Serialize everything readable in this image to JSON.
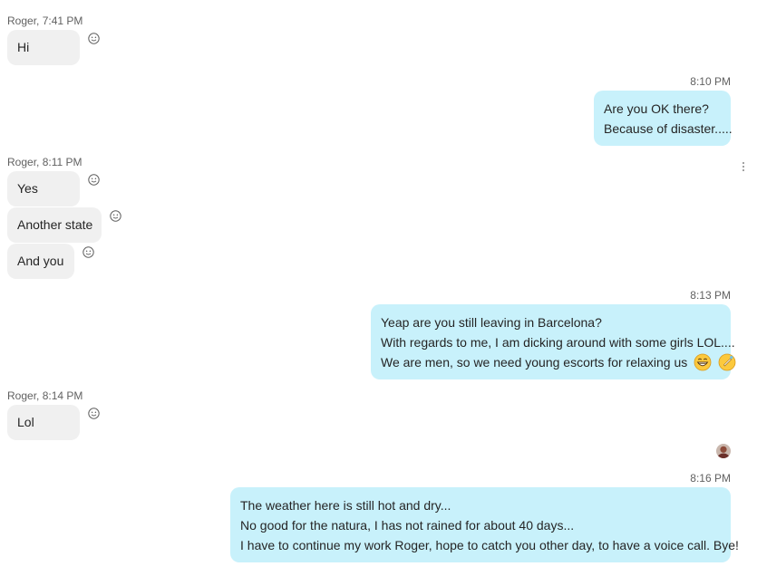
{
  "messages": [
    {
      "sender_time": "Roger, 7:41 PM",
      "lines": [
        "Hi"
      ]
    },
    {
      "time": "8:10 PM",
      "lines": [
        "Are you OK there?",
        "Because of disaster....."
      ]
    },
    {
      "sender_time": "Roger, 8:11 PM",
      "bubbles": [
        "Yes",
        "Another state",
        "And you"
      ]
    },
    {
      "time": "8:13 PM",
      "lines": [
        "Yeap are you still leaving in Barcelona?",
        "With regards to me, I am dicking around with some girls LOL....",
        "We are men, so we need young escorts for relaxing us"
      ],
      "emojis": [
        "grinning-face-icon",
        "sweat-smile-icon"
      ]
    },
    {
      "sender_time": "Roger, 8:14 PM",
      "lines": [
        "Lol"
      ]
    },
    {
      "time": "8:16 PM",
      "lines": [
        "The weather here is still hot and dry...",
        "No good for the natura, I has not rained for about 40 days...",
        "I have to continue my work Roger, hope to catch you other day, to have a voice call. Bye!"
      ]
    }
  ],
  "icons": {
    "reaction": "smiley-reaction-icon",
    "more": "more-options-icon",
    "read_receipt": "read-receipt-avatar"
  },
  "colors": {
    "incoming_bubble": "#f0f0f0",
    "outgoing_bubble": "#c8f1fb",
    "meta_text": "#616161"
  }
}
